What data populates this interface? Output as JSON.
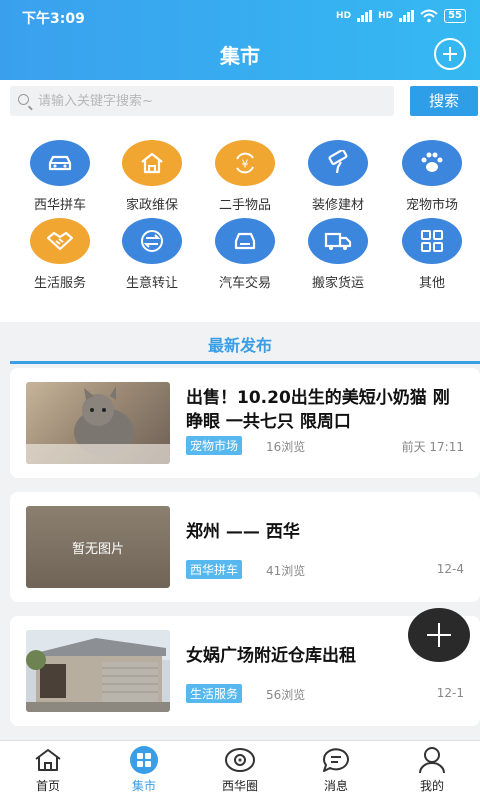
{
  "status_bar": {
    "time": "下午3:09",
    "battery": "55",
    "net1": "HD",
    "net2": "HD"
  },
  "header": {
    "title": "集市"
  },
  "search": {
    "placeholder": "请输入关键字搜索~",
    "button_label": "搜索"
  },
  "categories": [
    {
      "label": "西华拼车",
      "icon": "car-icon",
      "color": "#3d86dd"
    },
    {
      "label": "家政维保",
      "icon": "house-icon",
      "color": "#f2a632"
    },
    {
      "label": "二手物品",
      "icon": "yuan-exchange-icon",
      "color": "#f2a632"
    },
    {
      "label": "装修建材",
      "icon": "paint-roller-icon",
      "color": "#3d86dd"
    },
    {
      "label": "宠物市场",
      "icon": "paw-icon",
      "color": "#3d86dd"
    },
    {
      "label": "生活服务",
      "icon": "handshake-icon",
      "color": "#f2a632"
    },
    {
      "label": "生意转让",
      "icon": "transfer-icon",
      "color": "#3d86dd"
    },
    {
      "label": "汽车交易",
      "icon": "car-front-icon",
      "color": "#3d86dd"
    },
    {
      "label": "搬家货运",
      "icon": "truck-icon",
      "color": "#3d86dd"
    },
    {
      "label": "其他",
      "icon": "grid-icon",
      "color": "#3d86dd"
    }
  ],
  "section": {
    "latest_title": "最新发布"
  },
  "posts": [
    {
      "title": "出售！10.20出生的美短小奶猫 刚睁眼 一共七只 限周口",
      "tag": "宠物市场",
      "views": "16浏览",
      "time": "前天 17:11",
      "image": "kitten-photo"
    },
    {
      "title": "郑州 —— 西华",
      "tag": "西华拼车",
      "views": "41浏览",
      "time": "12-4",
      "image_text": "暂无图片"
    },
    {
      "title": "女娲广场附近仓库出租",
      "tag": "生活服务",
      "views": "56浏览",
      "time": "12-1",
      "image": "warehouse-photo"
    }
  ],
  "tabs": [
    {
      "label": "首页",
      "icon": "home-icon"
    },
    {
      "label": "集市",
      "icon": "market-icon",
      "active": true
    },
    {
      "label": "西华圈",
      "icon": "circle-icon"
    },
    {
      "label": "消息",
      "icon": "message-icon"
    },
    {
      "label": "我的",
      "icon": "user-icon"
    }
  ],
  "colors": {
    "primary": "#3a9ee6",
    "orange": "#f2a632",
    "blue": "#3d86dd"
  }
}
